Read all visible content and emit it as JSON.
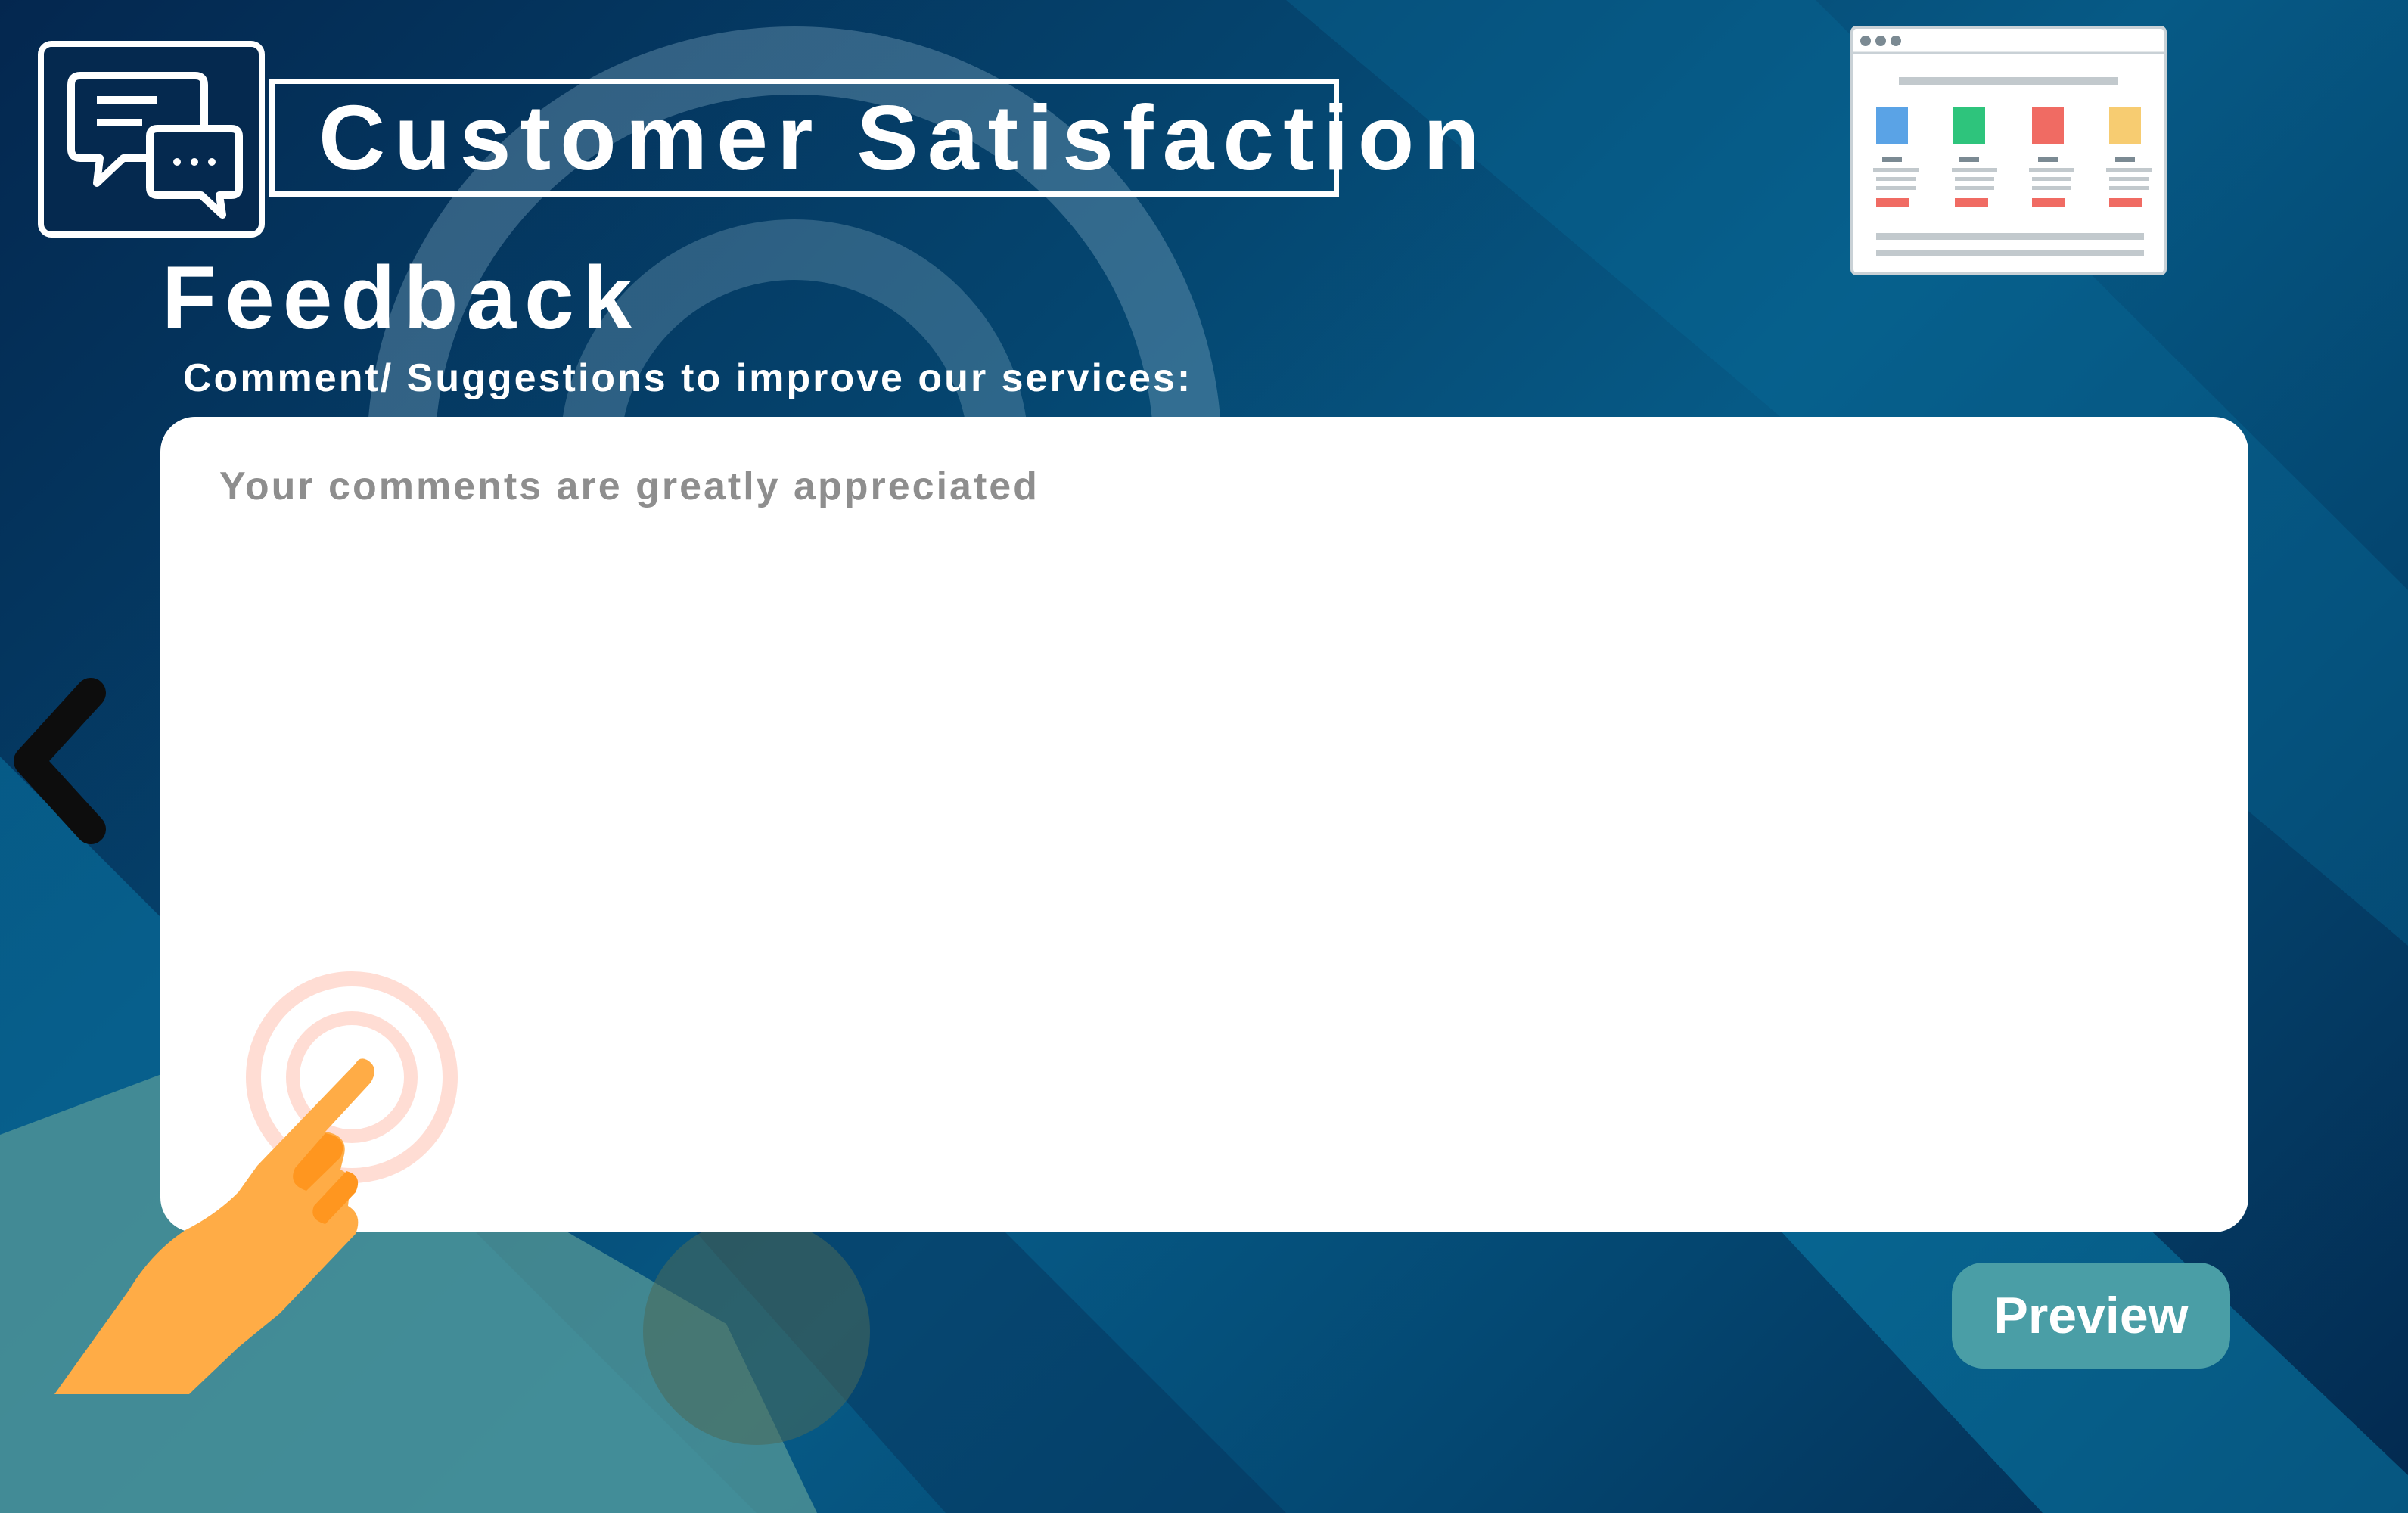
{
  "header": {
    "title": "Customer Satisfaction",
    "logo_icon": "chat-bubbles-icon"
  },
  "page": {
    "subtitle": "Feedback",
    "prompt": "Comment/ Suggestions to improve our services:"
  },
  "feedback_form": {
    "comment_placeholder": "Your comments are greatly appreciated",
    "comment_value": "",
    "preview_label": "Preview"
  },
  "icons": {
    "dashboard": "dashboard-window-icon",
    "back": "back-arrow-icon",
    "tap": "tap-hand-icon"
  },
  "colors": {
    "background": "#05456f",
    "title_border": "#ffffff",
    "panel": "#ffffff",
    "placeholder_text": "#8e8e8e",
    "preview_button": "#4a9ea6",
    "hand": "#ffac46",
    "tap_ripple": "#ffd9cf"
  }
}
